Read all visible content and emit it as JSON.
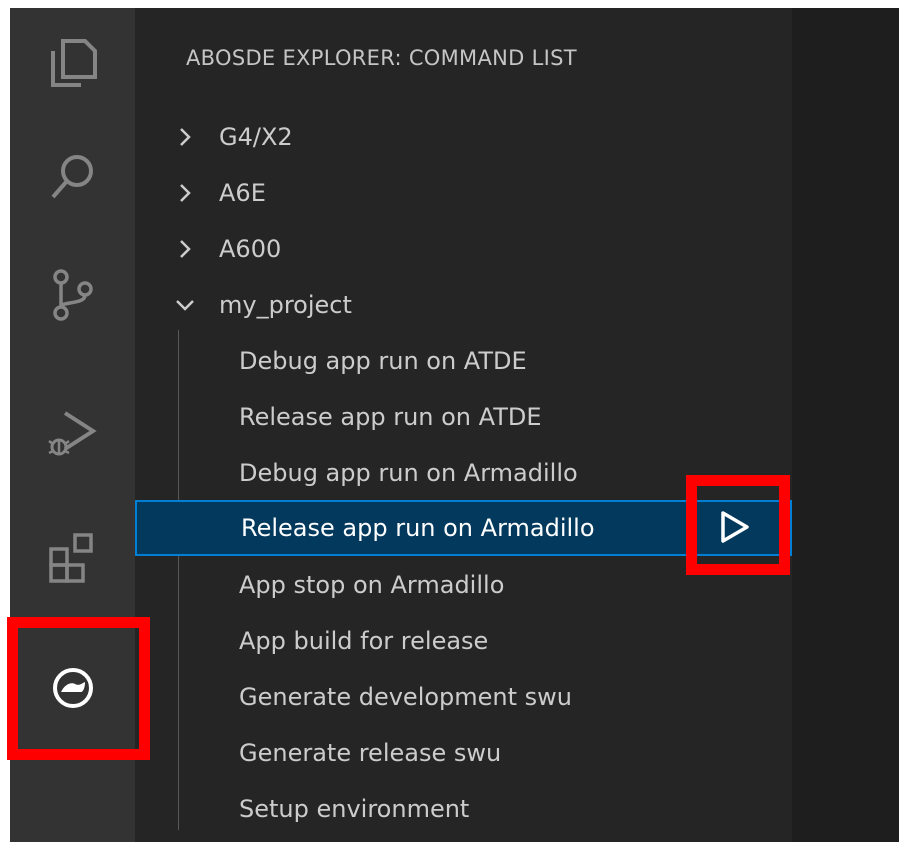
{
  "sidebar": {
    "title": "ABOSDE EXPLORER: COMMAND LIST",
    "groups": [
      {
        "label": "G4/X2",
        "expanded": false
      },
      {
        "label": "A6E",
        "expanded": false
      },
      {
        "label": "A600",
        "expanded": false
      },
      {
        "label": "my_project",
        "expanded": true
      }
    ],
    "commands": [
      "Debug app run on ATDE",
      "Release app run on ATDE",
      "Debug app run on Armadillo",
      "Release app run on Armadillo",
      "App stop on Armadillo",
      "App build for release",
      "Generate development swu",
      "Generate release swu",
      "Setup environment"
    ],
    "selected_command": "Release app run on Armadillo",
    "run_action_icon": "play-icon"
  },
  "activity_bar": {
    "icons": [
      "explorer-icon",
      "search-icon",
      "source-control-icon",
      "run-debug-icon",
      "extensions-icon",
      "abosde-icon"
    ],
    "active": "abosde-icon"
  },
  "colors": {
    "activity_bar": "#333333",
    "sidebar": "#252526",
    "editor": "#1e1e1e",
    "selection": "#04395e",
    "selection_border": "#007fd4",
    "highlight": "#ff0000"
  }
}
